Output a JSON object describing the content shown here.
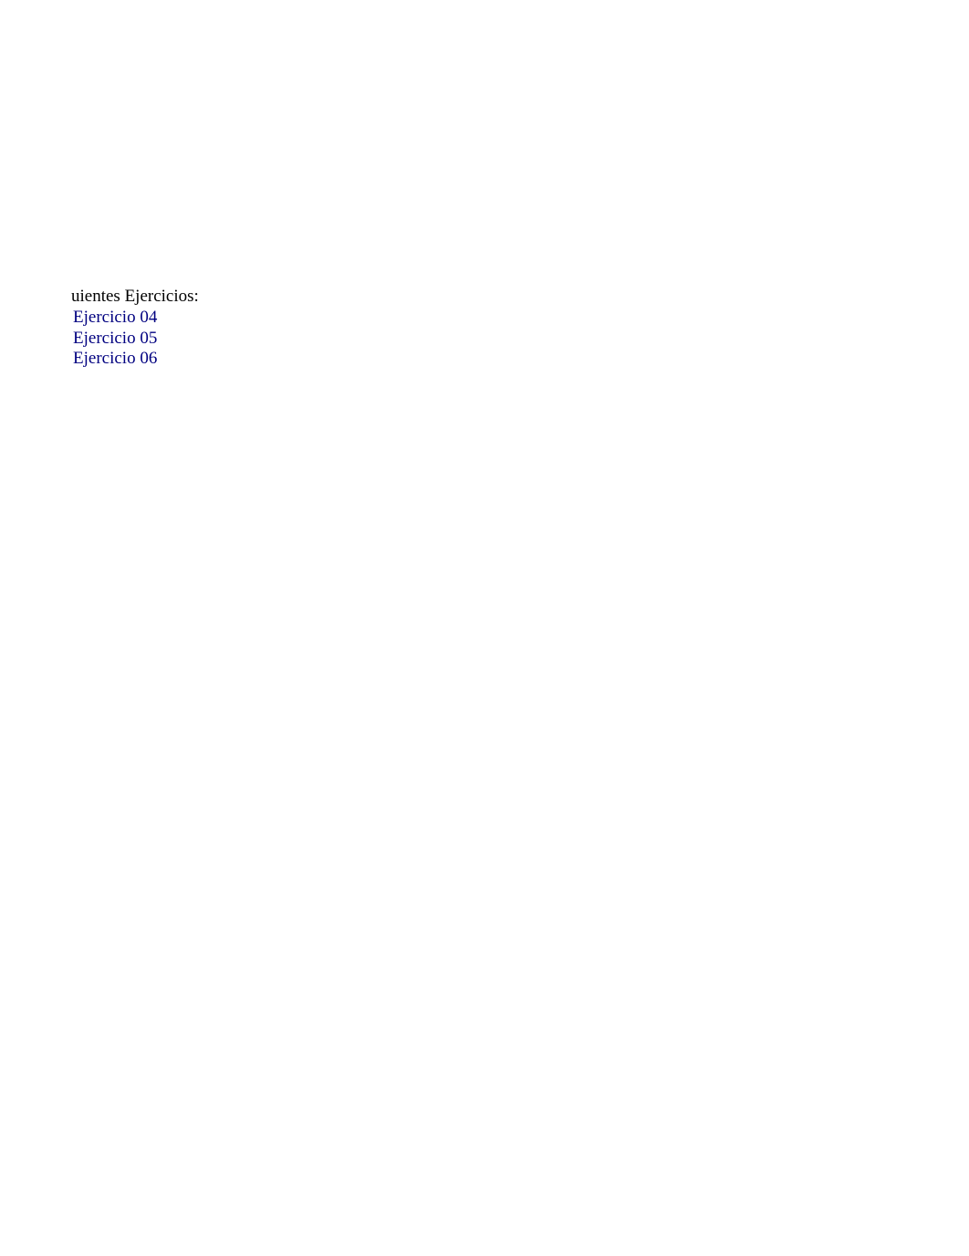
{
  "heading": "uientes Ejercicios:",
  "links": [
    {
      "label": "Ejercicio 04"
    },
    {
      "label": "Ejercicio 05"
    },
    {
      "label": "Ejercicio 06"
    }
  ]
}
